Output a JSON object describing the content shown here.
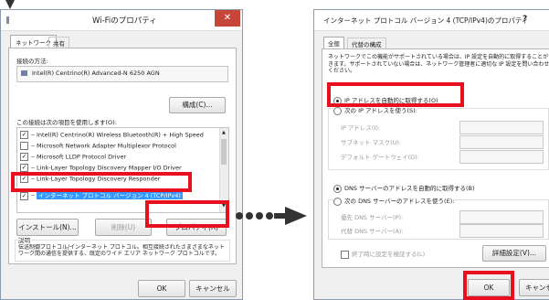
{
  "left_dialog": {
    "title": "Wi-Fiのプロパティ",
    "tabs": [
      "ネットワーク",
      "共有"
    ],
    "connect_using_label": "接続の方法:",
    "adapter_name": "Intel(R) Centrino(R) Advanced-N 6250 AGN",
    "configure_label": "構成(C)...",
    "items_label": "この接続は次の項目を使用します(O):",
    "items": [
      {
        "label": "Intel(R) Centrino(R) Wireless Bluetooth(R) + High Speed",
        "checked": true
      },
      {
        "label": "Microsoft Network Adapter Multiplexor Protocol",
        "checked": false
      },
      {
        "label": "Microsoft LLDP Protocol Driver",
        "checked": true
      },
      {
        "label": "Link-Layer Topology Discovery Mapper I/O Driver",
        "checked": true
      },
      {
        "label": "Link-Layer Topology Discovery Responder",
        "checked": true
      },
      {
        "label": "インターネット プロトコル バージョン 4 (TCP/IPv4)",
        "checked": true
      }
    ],
    "install_label": "インストール(N)...",
    "uninstall_label": "削除(U)",
    "properties_label": "プロパティ(R)",
    "description_label": "説明",
    "description_text": "伝送制御プロトコル/インターネット プロトコル。相互接続されたさまざまなネットワーク間の通信を提供する、既定のワイド エリア ネットワーク プロトコルです。",
    "ok_label": "OK",
    "cancel_label": "キャンセル"
  },
  "right_dialog": {
    "title": "インターネット プロトコル バージョン 4 (TCP/IPv4)のプロパティ",
    "help_glyph": "?",
    "tabs": [
      "全般",
      "代替の構成"
    ],
    "intro_text": "ネットワークでこの機能がサポートされている場合は、IP 設定を自動的に取得することができます。サポートされていない場合は、ネットワーク管理者に適切な IP 設定を問い合わせてください。",
    "auto_ip_label": "IP アドレスを自動的に取得する(O)",
    "manual_ip_label": "次の IP アドレスを使う(S):",
    "ip_label": "IP アドレス(I):",
    "subnet_label": "サブネット マスク(U):",
    "gateway_label": "デフォルト ゲートウェイ(D):",
    "auto_dns_label": "DNS サーバーのアドレスを自動的に取得する(B)",
    "manual_dns_label": "次の DNS サーバーのアドレスを使う(E):",
    "preferred_dns_label": "優先 DNS サーバー(P):",
    "alternate_dns_label": "代替 DNS サーバー(A):",
    "validate_label": "終了時に設定を検証する(L)",
    "advanced_label": "詳細設定(V)...",
    "ok_label": "OK",
    "cancel_label": "キャンセル"
  },
  "colors": {
    "highlight": "#e8101e",
    "selection": "#3399ff",
    "arrow": "#333333"
  }
}
